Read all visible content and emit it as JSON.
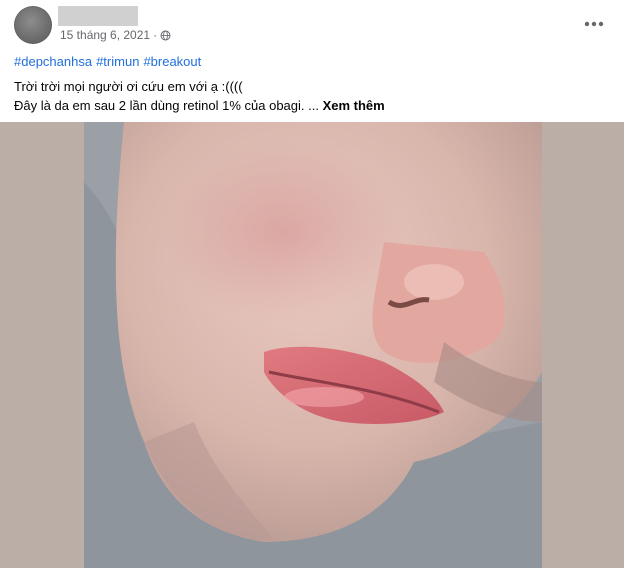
{
  "post": {
    "date": "15 tháng 6, 2021",
    "meta_separator": "·",
    "hashtags": [
      "#depchanhsa",
      "#trimun",
      "#breakout"
    ],
    "text_line1": "Trời trời mọi người ơi cứu em với ạ :((((",
    "text_line2": "Đây là da em sau 2 lần dùng retinol 1% của obagi. ...",
    "see_more": "Xem thêm"
  },
  "icons": {
    "privacy": "globe-icon",
    "options": "more-horizontal-icon"
  },
  "colors": {
    "hashtag": "#216fdb",
    "meta": "#65676b",
    "media_background": "#baaea6"
  }
}
